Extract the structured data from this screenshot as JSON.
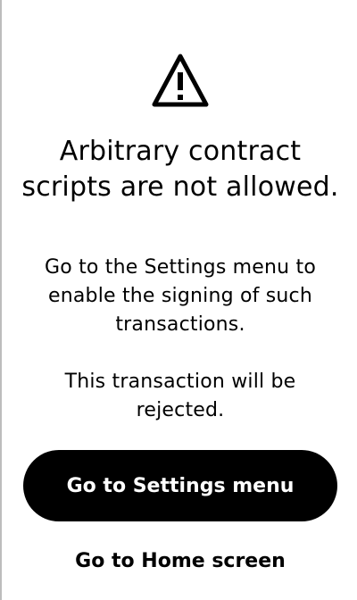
{
  "icon": "warning-triangle-icon",
  "title": "Arbitrary contract scripts are not allowed.",
  "body": {
    "line1": "Go to the Settings menu to enable the signing of such transactions.",
    "line2": "This transaction will be rejected."
  },
  "buttons": {
    "primary_label": "Go to Settings menu",
    "secondary_label": "Go to Home screen"
  },
  "colors": {
    "background": "#ffffff",
    "text": "#000000",
    "primary_button": "#000000",
    "primary_button_text": "#ffffff"
  }
}
